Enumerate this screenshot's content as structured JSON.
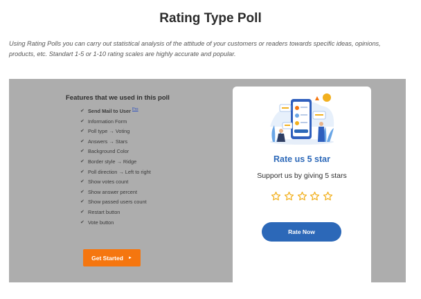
{
  "page": {
    "title": "Rating Type Poll",
    "intro": "Using Rating Polls you can carry out statistical analysis of the attitude of your customers or readers towards specific ideas, opinions, products, etc. Standart 1-5 or 1-10 rating scales are highly accurate and popular."
  },
  "features": {
    "title": "Features that we used in this poll",
    "items": [
      {
        "label": "Send Mail to User",
        "pro": "Pro"
      },
      {
        "label": "Information Form"
      },
      {
        "label": "Poll type → Voting"
      },
      {
        "label": "Answers → Stars"
      },
      {
        "label": "Background Color"
      },
      {
        "label": "Border style → Ridge"
      },
      {
        "label": "Poll direction → Left to right"
      },
      {
        "label": "Show votes count"
      },
      {
        "label": "Show answer percent"
      },
      {
        "label": "Show passed users count"
      },
      {
        "label": "Restart button"
      },
      {
        "label": "Vote button"
      }
    ],
    "check_icon": "check-icon",
    "get_started_label": "Get Started",
    "get_started_icon": "play-arrow-icon"
  },
  "poll_card": {
    "heading": "Rate us 5 star",
    "subheading": "Support us by giving 5 stars",
    "rating_value": 0,
    "rating_max": 5,
    "star_icon": "star-outline-icon",
    "rate_button_label": "Rate Now"
  },
  "colors": {
    "panel_bg": "#adadad",
    "accent_blue": "#2c68b8",
    "accent_orange": "#f5760f",
    "star": "#f2b01e"
  }
}
